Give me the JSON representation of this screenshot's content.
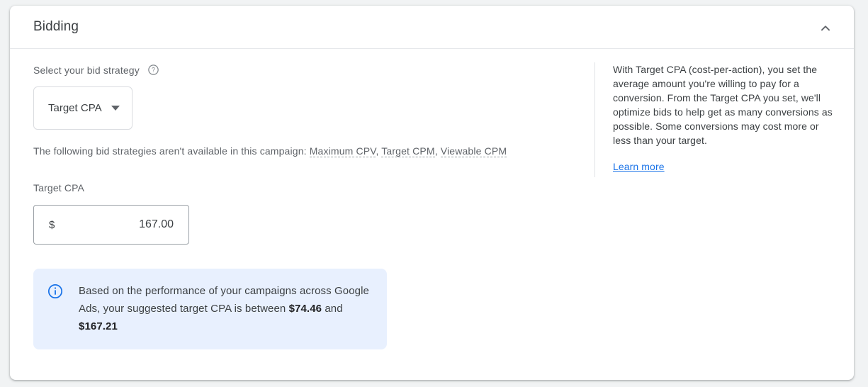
{
  "card": {
    "title": "Bidding",
    "collapse_icon": "chevron-up-icon"
  },
  "bid_strategy": {
    "label": "Select your bid strategy",
    "help_icon": "help-circle-icon",
    "selected": "Target CPA",
    "caret_icon": "dropdown-caret-icon",
    "unavailable_prefix": "The following bid strategies aren't available in this campaign:",
    "unavailable_items": [
      "Maximum CPV",
      "Target CPM",
      "Viewable CPM"
    ],
    "separator": ", "
  },
  "target_cpa": {
    "label": "Target CPA",
    "currency_symbol": "$",
    "value": "167.00",
    "placeholder": "0.00"
  },
  "callout": {
    "icon": "info-circle-icon",
    "text_part1": "Based on the performance of your campaigns across Google Ads, your suggested target CPA is between ",
    "amount_low": "$74.46",
    "text_part2": " and ",
    "amount_high": "$167.21",
    "background_color": "#e8f0fe",
    "accent_color": "#1a73e8"
  },
  "help_panel": {
    "text": "With Target CPA (cost-per-action), you set the average amount you're willing to pay for a conversion. From the Target CPA you set, we'll optimize bids to help get as many conversions as possible. Some conversions may cost more or less than your target.",
    "link_label": "Learn more",
    "link_color": "#1a73e8"
  }
}
